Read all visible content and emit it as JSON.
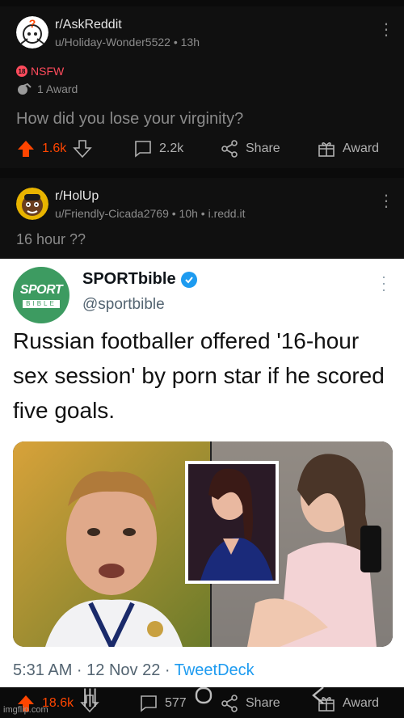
{
  "post1": {
    "subreddit": "r/AskReddit",
    "meta": "u/Holiday-Wonder5522 • 13h",
    "nsfw_label": "NSFW",
    "nsfw_badge": "18",
    "award_text": "1 Award",
    "title": "How did you lose your virginity?",
    "actions": {
      "upvotes": "1.6k",
      "comments": "2.2k",
      "share": "Share",
      "award": "Award"
    }
  },
  "post2": {
    "subreddit": "r/HolUp",
    "meta": "u/Friendly-Cicada2769 • 10h • i.redd.it",
    "title": "16 hour ??"
  },
  "tweet": {
    "logo_top": "SPORT",
    "logo_bottom": "BIBLE",
    "name": "SPORTbible",
    "handle": "@sportbible",
    "text": "Russian footballer offered '16-hour sex session' by porn star if he scored five goals.",
    "timestamp": "5:31 AM · 12 Nov 22 · ",
    "via": "TweetDeck"
  },
  "bottom_actions": {
    "upvotes": "18.6k",
    "comments": "577",
    "share": "Share",
    "award": "Award"
  },
  "watermark": "imgflip.com",
  "colors": {
    "upvote": "#ff4500",
    "verified": "#1d9bf0",
    "sportbible": "#3d9b61",
    "nsfw": "#ff4b5c"
  },
  "icons": [
    "upvote-arrow-icon",
    "downvote-arrow-icon",
    "comment-icon",
    "share-icon",
    "award-icon",
    "kebab-menu-icon",
    "verified-badge-icon"
  ]
}
